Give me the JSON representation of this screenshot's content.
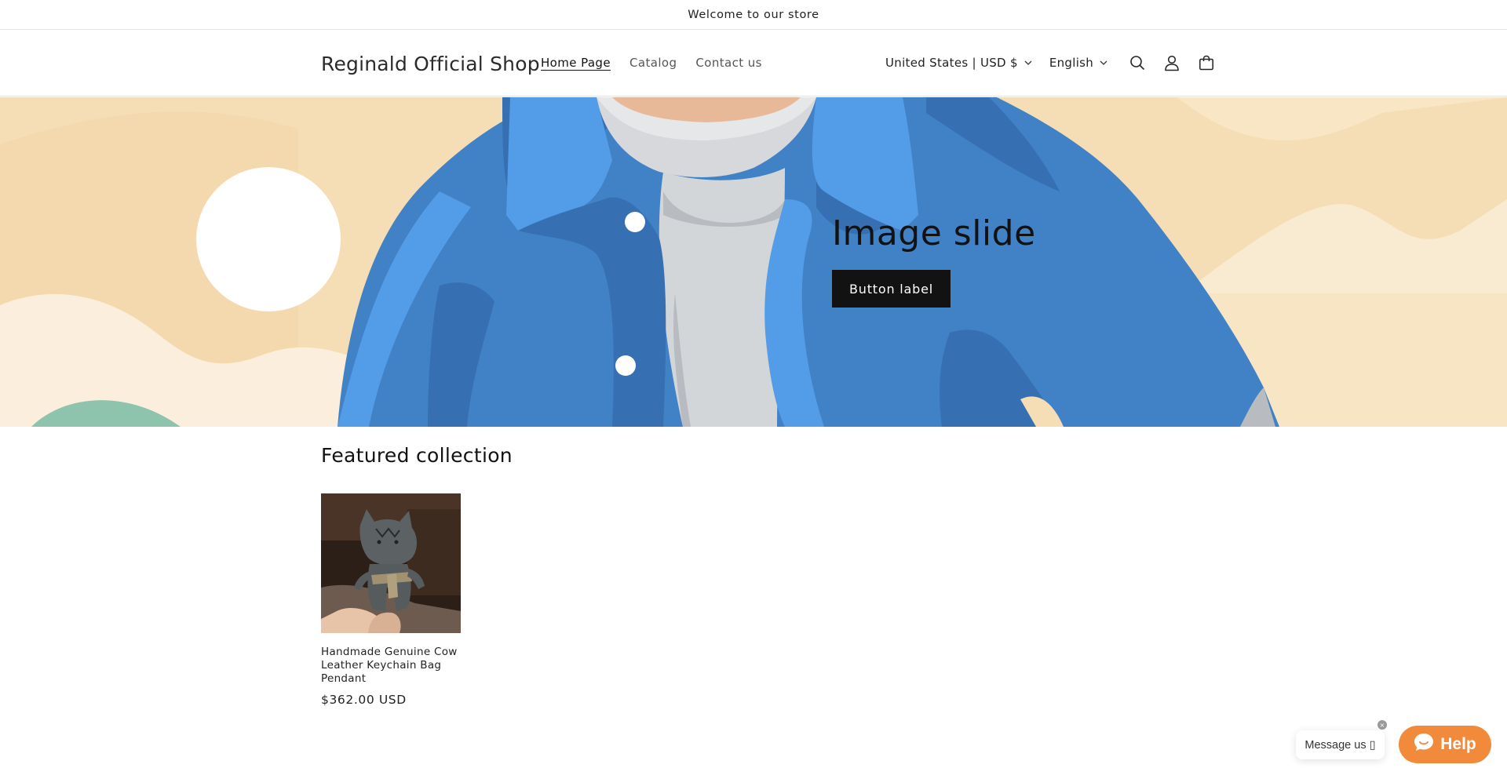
{
  "announcement": {
    "text": "Welcome to our store"
  },
  "header": {
    "logo": "Reginald Official Shop",
    "nav": [
      {
        "label": "Home Page",
        "active": true
      },
      {
        "label": "Catalog",
        "active": false
      },
      {
        "label": "Contact us",
        "active": false
      }
    ],
    "country_selector": "United States | USD $",
    "language_selector": "English",
    "icons": [
      "search-icon",
      "account-icon",
      "cart-icon"
    ]
  },
  "hero": {
    "title": "Image slide",
    "button_label": "Button label"
  },
  "featured": {
    "title": "Featured collection",
    "products": [
      {
        "name": "Handmade Genuine Cow Leather Keychain Bag Pendant",
        "price": "$362.00 USD"
      }
    ]
  },
  "chat": {
    "message_label": "Message us ▯",
    "help_label": "Help",
    "close_glyph": "×"
  },
  "colors": {
    "help_button": "#f28a3c",
    "hero_bg": "#f5deb5",
    "jacket": "#4181c6",
    "button_bg": "#121212"
  }
}
